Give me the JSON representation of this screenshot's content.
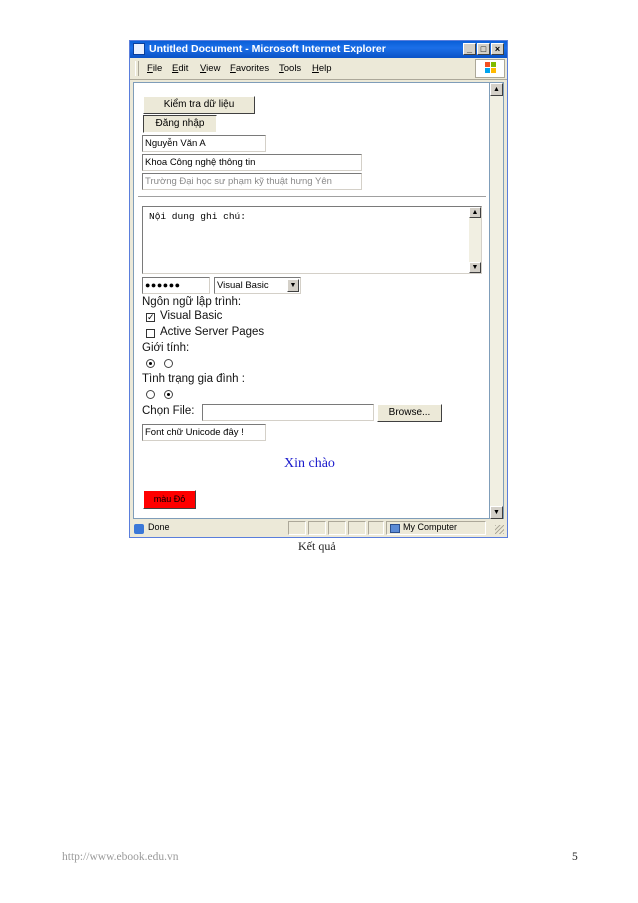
{
  "window": {
    "title": "Untitled Document - Microsoft Internet Explorer",
    "minimize": "_",
    "maximize": "□",
    "close": "×"
  },
  "menu": [
    "File",
    "Edit",
    "View",
    "Favorites",
    "Tools",
    "Help"
  ],
  "page": {
    "check_button": "Kiểm tra dữ liệu",
    "login_button": "Đăng nhập",
    "name_value": "Nguyễn Văn A",
    "faculty_value": "Khoa Công nghệ thông tin",
    "school_value": "Trường Đại học sư phạm kỹ thuật hưng Yên",
    "notes_value": "Nội dung ghi chú:",
    "password_mask": "●●●●●●",
    "language_select": "Visual Basic",
    "language_label": "Ngôn ngữ lập trình:",
    "option_vb": "Visual Basic",
    "option_vb_checked": true,
    "option_asp": "Active Server Pages",
    "option_asp_checked": false,
    "gender_label": "Giới tính:",
    "gender_selected": 0,
    "marital_label": "Tình trạng gia đình :",
    "marital_selected": 1,
    "file_label": "Chọn File:",
    "file_value": "",
    "browse_button": "Browse...",
    "unicode_value": "Font chữ Unicode đây !",
    "greeting": "Xin chào",
    "red_button": "màu Đỏ"
  },
  "status": {
    "text": "Done",
    "zone": "My Computer"
  },
  "caption": "Kết quả",
  "footer": {
    "url": "http://www.ebook.edu.vn",
    "page_number": "5"
  },
  "colors": {
    "titlebar": "#0a5fd8",
    "greeting": "#1a1acc",
    "red_button": "#ff0000"
  }
}
